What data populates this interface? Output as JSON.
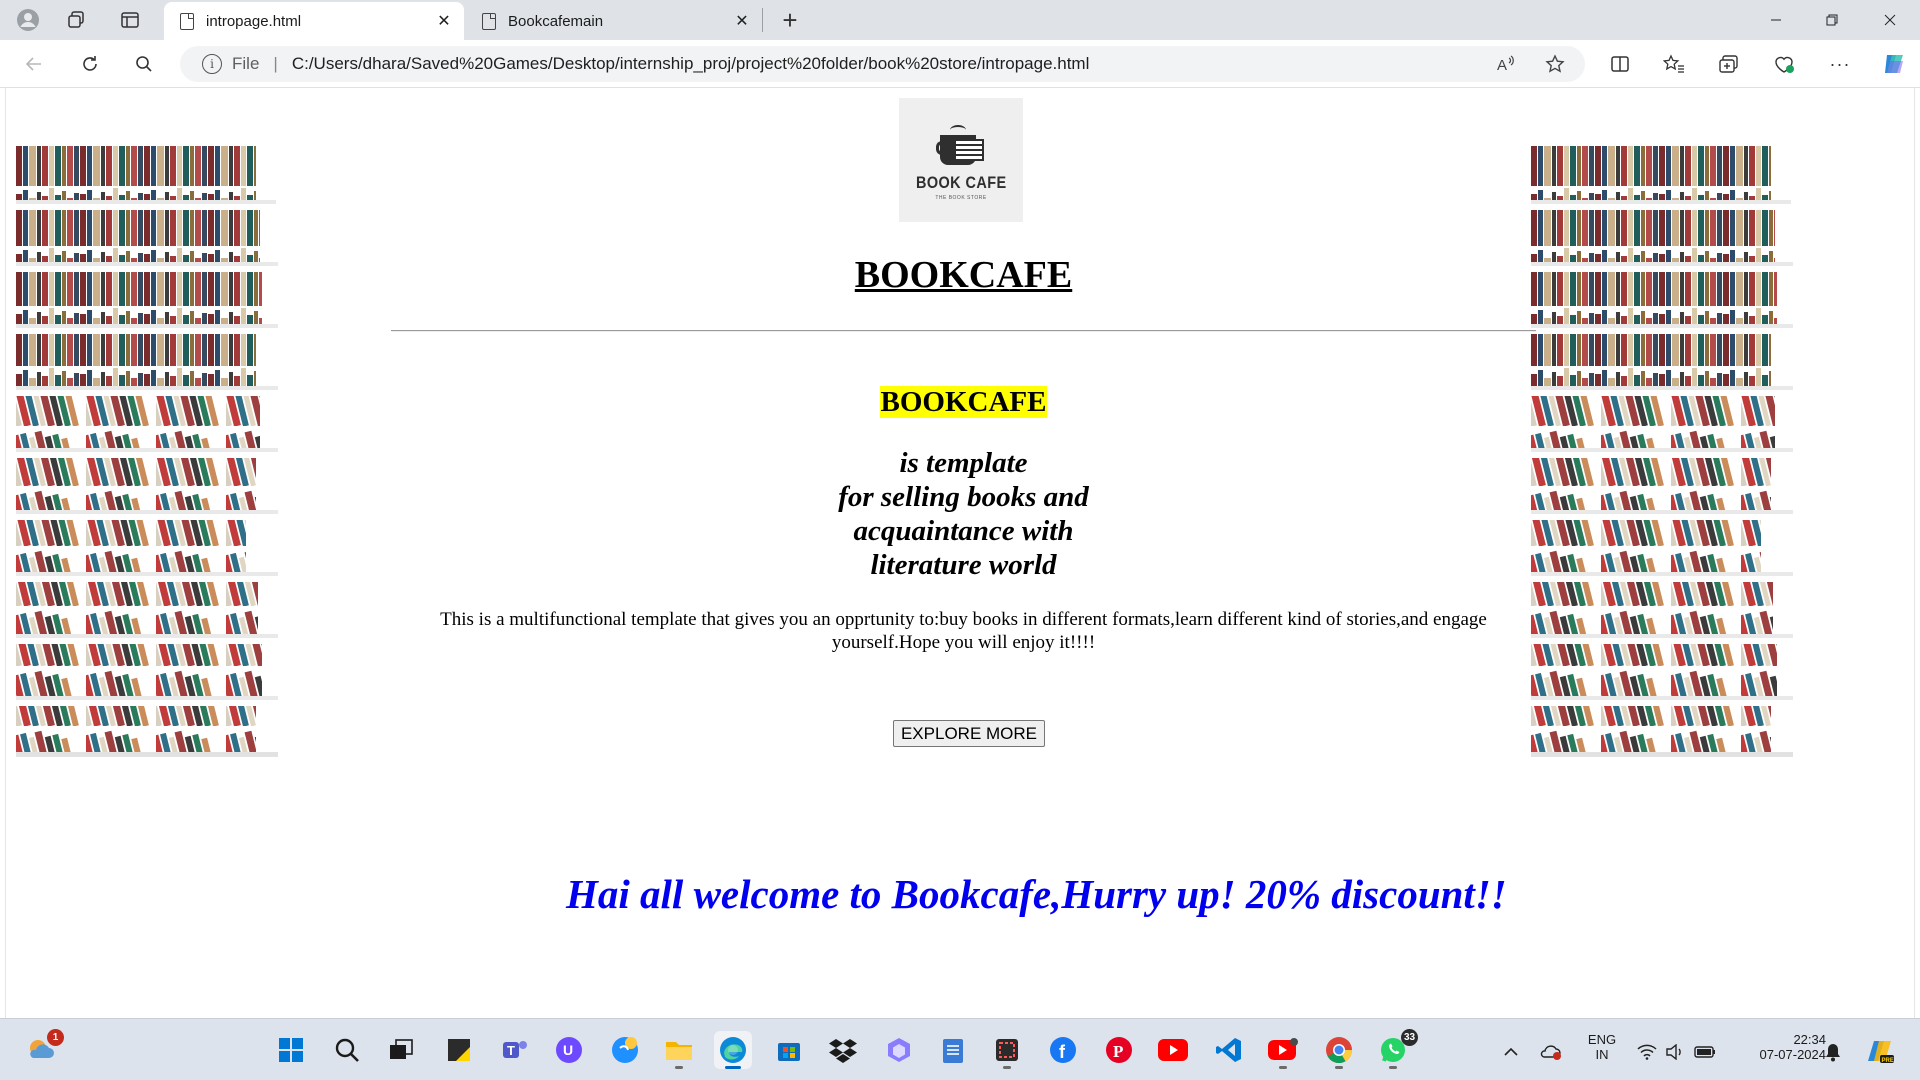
{
  "browser": {
    "tabs": [
      {
        "title": "intropage.html",
        "active": true
      },
      {
        "title": "Bookcafemain",
        "active": false
      }
    ],
    "new_tab_glyph": "+",
    "address": {
      "security_label": "File",
      "url": "C:/Users/dhara/Saved%20Games/Desktop/internship_proj/project%20folder/book%20store/intropage.html"
    },
    "icons": {
      "profile": "profile-icon",
      "workspaces": "workspaces-icon",
      "tab_actions": "tab-actions-icon",
      "back": "back-arrow-icon",
      "refresh": "refresh-icon",
      "search": "search-icon",
      "read_aloud": "read-aloud-icon",
      "favorite": "star-icon",
      "split_screen": "split-screen-icon",
      "favorites": "favorites-icon",
      "collections": "collections-icon",
      "browser_essentials": "browser-essentials-icon",
      "more": "more-icon",
      "copilot": "copilot-icon"
    }
  },
  "page": {
    "logo": {
      "name": "BOOK CAFE",
      "tagline": "THE BOOK STORE"
    },
    "title": "BOOKCAFE",
    "highlight_title": "BOOKCAFE",
    "tagline_lines": [
      "is template",
      "for selling books and",
      "acquaintance with",
      "literature world"
    ],
    "description": "This is a multifunctional template that gives you an opprtunity to:buy books in different formats,learn different kind of stories,and engage yourself.Hope you will enjoy it!!!!",
    "button_label": "EXPLORE MORE",
    "marquee": "Hai all welcome to Bookcafe,Hurry up! 20% discount!!",
    "colors": {
      "highlight": "#ffff00",
      "marquee": "#0000ee"
    }
  },
  "taskbar": {
    "weather_badge": "1",
    "whatsapp_badge": "33",
    "language": {
      "line1": "ENG",
      "line2": "IN"
    },
    "time": "22:34",
    "date": "07-07-2024",
    "apps": [
      "windows-start-icon",
      "search-icon",
      "task-view-icon",
      "sticky-notes-icon",
      "teams-icon",
      "proton-vpn-icon",
      "weather-app-icon",
      "file-explorer-icon",
      "edge-icon",
      "microsoft-store-icon",
      "dropbox-icon",
      "copilot-app-icon",
      "notepad-icon",
      "snipping-tool-icon",
      "facebook-icon",
      "pinterest-icon",
      "youtube-icon",
      "vscode-icon",
      "youtube-pwa-icon",
      "chrome-icon",
      "whatsapp-icon"
    ]
  }
}
